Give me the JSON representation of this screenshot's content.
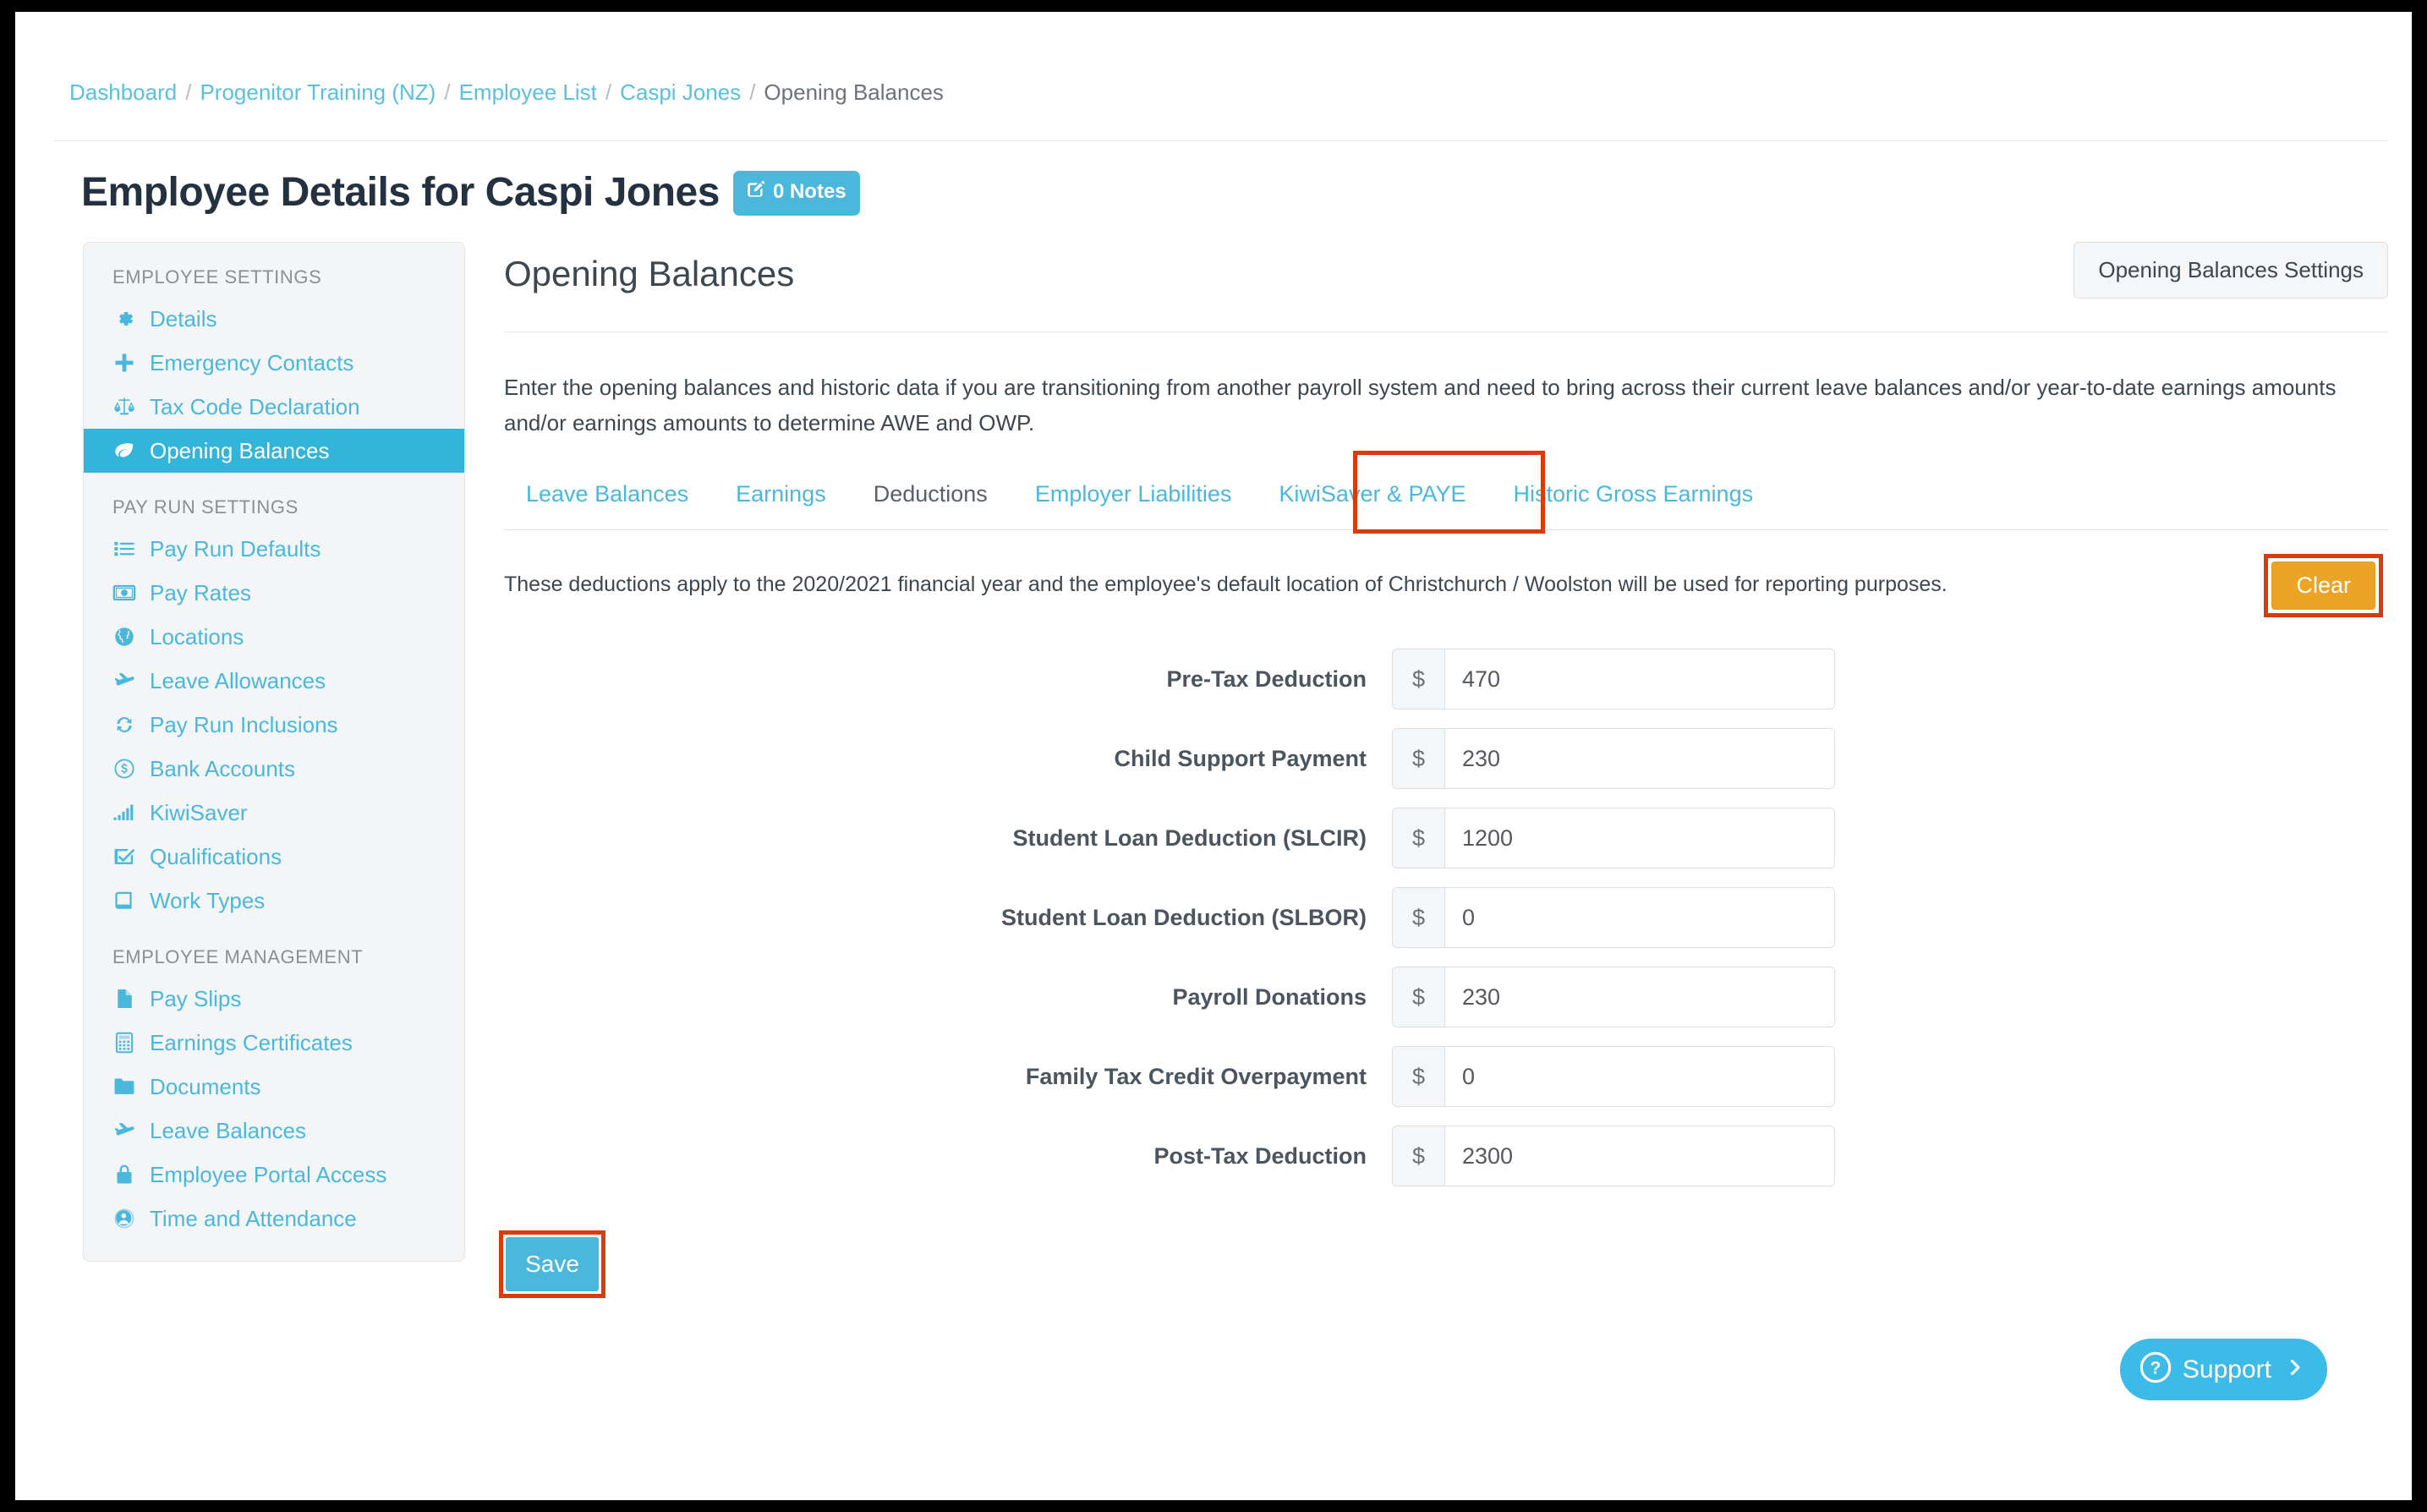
{
  "breadcrumb": {
    "items": [
      {
        "label": "Dashboard",
        "link": true
      },
      {
        "label": "Progenitor Training (NZ)",
        "link": true
      },
      {
        "label": "Employee List",
        "link": true
      },
      {
        "label": "Caspi Jones",
        "link": true
      },
      {
        "label": "Opening Balances",
        "link": false
      }
    ],
    "separator": "/"
  },
  "header": {
    "title": "Employee Details for Caspi Jones",
    "notes_badge": "0 Notes"
  },
  "sidebar": {
    "groups": [
      {
        "title": "EMPLOYEE SETTINGS",
        "items": [
          {
            "label": "Details",
            "icon": "gear-icon",
            "active": false
          },
          {
            "label": "Emergency Contacts",
            "icon": "plus-icon",
            "active": false
          },
          {
            "label": "Tax Code Declaration",
            "icon": "scales-icon",
            "active": false
          },
          {
            "label": "Opening Balances",
            "icon": "leaf-icon",
            "active": true
          }
        ]
      },
      {
        "title": "PAY RUN SETTINGS",
        "items": [
          {
            "label": "Pay Run Defaults",
            "icon": "list-icon",
            "active": false
          },
          {
            "label": "Pay Rates",
            "icon": "money-icon",
            "active": false
          },
          {
            "label": "Locations",
            "icon": "globe-icon",
            "active": false
          },
          {
            "label": "Leave Allowances",
            "icon": "plane-icon",
            "active": false
          },
          {
            "label": "Pay Run Inclusions",
            "icon": "refresh-icon",
            "active": false
          },
          {
            "label": "Bank Accounts",
            "icon": "dollar-circle-icon",
            "active": false
          },
          {
            "label": "KiwiSaver",
            "icon": "signal-bars-icon",
            "active": false
          },
          {
            "label": "Qualifications",
            "icon": "check-square-icon",
            "active": false
          },
          {
            "label": "Work Types",
            "icon": "book-icon",
            "active": false
          }
        ]
      },
      {
        "title": "EMPLOYEE MANAGEMENT",
        "items": [
          {
            "label": "Pay Slips",
            "icon": "file-icon",
            "active": false
          },
          {
            "label": "Earnings Certificates",
            "icon": "calculator-icon",
            "active": false
          },
          {
            "label": "Documents",
            "icon": "folder-icon",
            "active": false
          },
          {
            "label": "Leave Balances",
            "icon": "plane-icon",
            "active": false
          },
          {
            "label": "Employee Portal Access",
            "icon": "lock-icon",
            "active": false
          },
          {
            "label": "Time and Attendance",
            "icon": "user-clock-icon",
            "active": false
          }
        ]
      }
    ]
  },
  "main": {
    "title": "Opening Balances",
    "settings_button": "Opening Balances Settings",
    "intro": "Enter the opening balances and historic data if you are transitioning from another payroll system and need to bring across their current leave balances and/or year-to-date earnings amounts and/or earnings amounts to determine AWE and OWP.",
    "tabs": [
      {
        "label": "Leave Balances",
        "active": false
      },
      {
        "label": "Earnings",
        "active": false
      },
      {
        "label": "Deductions",
        "active": true
      },
      {
        "label": "Employer Liabilities",
        "active": false
      },
      {
        "label": "KiwiSaver & PAYE",
        "active": false
      },
      {
        "label": "Historic Gross Earnings",
        "active": false
      }
    ],
    "notice": "These deductions apply to the 2020/2021 financial year and the employee's default location of Christchurch / Woolston will be used for reporting purposes.",
    "clear_button": "Clear",
    "currency_symbol": "$",
    "fields": [
      {
        "label": "Pre-Tax Deduction",
        "value": "470"
      },
      {
        "label": "Child Support Payment",
        "value": "230"
      },
      {
        "label": "Student Loan Deduction (SLCIR)",
        "value": "1200"
      },
      {
        "label": "Student Loan Deduction (SLBOR)",
        "value": "0"
      },
      {
        "label": "Payroll Donations",
        "value": "230"
      },
      {
        "label": "Family Tax Credit Overpayment",
        "value": "0"
      },
      {
        "label": "Post-Tax Deduction",
        "value": "2300"
      }
    ],
    "save_button": "Save"
  },
  "support": {
    "label": "Support",
    "icon": "question-circle-icon",
    "chevron": "chevron-right-icon"
  },
  "colors": {
    "accent_blue": "#4bb8db",
    "active_blue": "#33b4da",
    "annotation_red": "#d93c0c",
    "clear_amber": "#eca426",
    "support_blue": "#3cbbe8",
    "heading_dark": "#243140"
  }
}
